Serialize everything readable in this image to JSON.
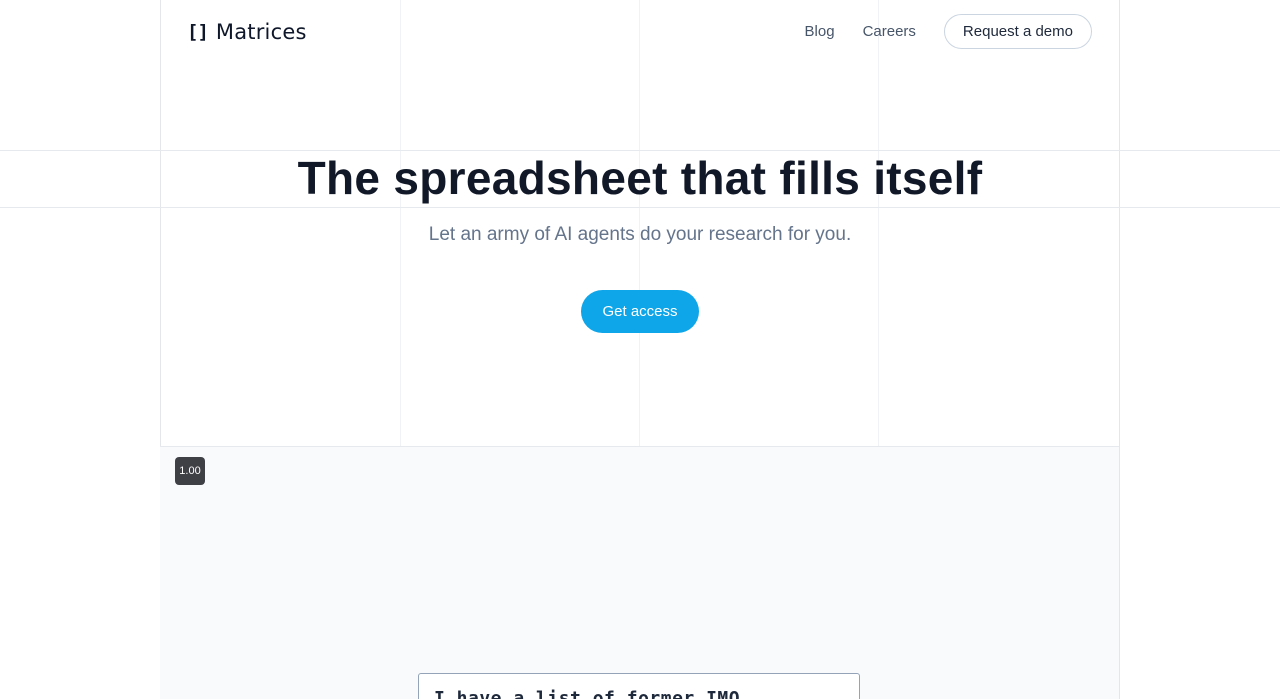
{
  "header": {
    "logo_icon": "[]",
    "brand": "Matrices",
    "nav": [
      {
        "label": "Blog"
      },
      {
        "label": "Careers"
      }
    ],
    "demo_button": "Request a demo"
  },
  "hero": {
    "title": "The spreadsheet that fills itself",
    "subtitle": "Let an army of AI agents do your research for you.",
    "cta": "Get access"
  },
  "demo": {
    "zoom_badge": "1.00",
    "prompt_text": "I have a list of former IMO"
  },
  "colors": {
    "accent": "#0ea5e9",
    "title": "#111827",
    "muted": "#64748b",
    "badge_bg": "#3f3f46",
    "demo_bg": "#f8fafc"
  }
}
